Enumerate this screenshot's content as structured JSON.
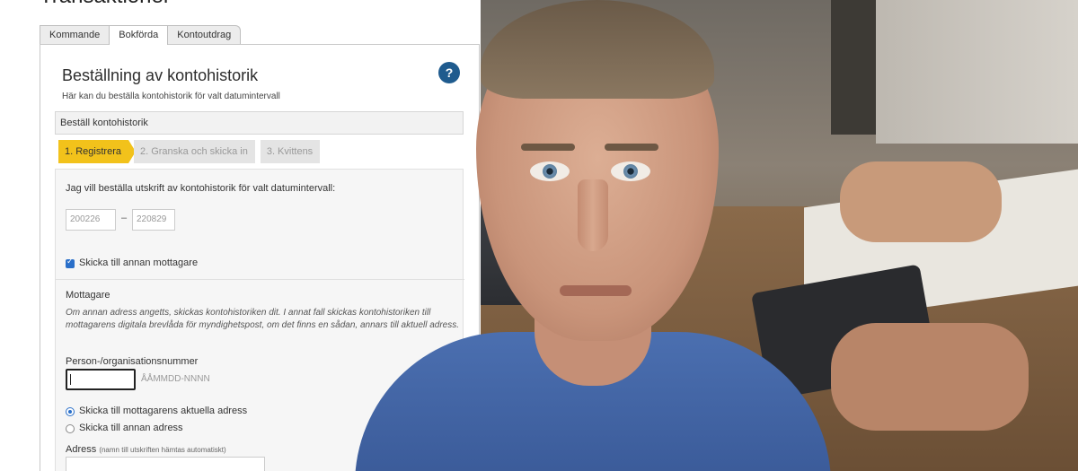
{
  "page": {
    "heading": "Transaktioner"
  },
  "tabs": [
    {
      "label": "Kommande"
    },
    {
      "label": "Bokförda"
    },
    {
      "label": "Kontoutdrag"
    }
  ],
  "card": {
    "title": "Beställning av kontohistorik",
    "subtitle": "Här kan du beställa kontohistorik för valt datumintervall",
    "help_icon": "?",
    "section_label": "Beställ kontohistorik"
  },
  "steps": [
    {
      "label": "1. Registrera"
    },
    {
      "label": "2. Granska och skicka in"
    },
    {
      "label": "3. Kvittens"
    }
  ],
  "form": {
    "date_prompt": "Jag vill beställa utskrift av kontohistorik för valt datumintervall:",
    "date_from": "200226",
    "date_sep": "–",
    "date_to": "220829",
    "checkbox_label": "Skicka till annan mottagare",
    "recipient_title": "Mottagare",
    "recipient_info": "Om annan adress angetts, skickas kontohistoriken dit. I annat fall skickas kontohistoriken till mottagarens digitala brevlåda för myndighetspost, om det finns en sådan, annars till aktuell adress.",
    "pnr_label": "Person-/organisationsnummer",
    "pnr_placeholder": "ÅÅMMDD-NNNN",
    "radio1_label": "Skicka till mottagarens aktuella adress",
    "radio2_label": "Skicka till annan adress",
    "address_label": "Adress",
    "address_note": "(namn till utskriften hämtas automatiskt)"
  }
}
